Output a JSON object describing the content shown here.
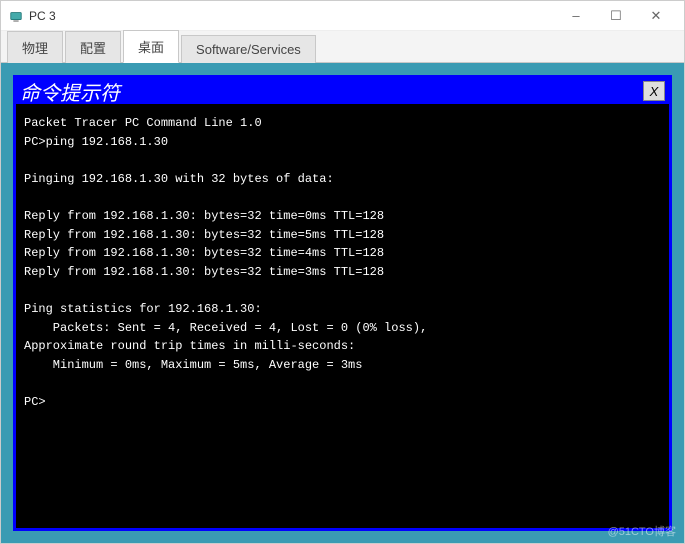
{
  "window": {
    "title": "PC 3",
    "controls": {
      "minimize": "–",
      "maximize": "☐",
      "close": "✕"
    }
  },
  "tabs": {
    "items": [
      {
        "label": "物理"
      },
      {
        "label": "配置"
      },
      {
        "label": "桌面"
      },
      {
        "label": "Software/Services"
      }
    ]
  },
  "console": {
    "title": "命令提示符",
    "close_label": "X",
    "lines": [
      "Packet Tracer PC Command Line 1.0",
      "PC>ping 192.168.1.30",
      "",
      "Pinging 192.168.1.30 with 32 bytes of data:",
      "",
      "Reply from 192.168.1.30: bytes=32 time=0ms TTL=128",
      "Reply from 192.168.1.30: bytes=32 time=5ms TTL=128",
      "Reply from 192.168.1.30: bytes=32 time=4ms TTL=128",
      "Reply from 192.168.1.30: bytes=32 time=3ms TTL=128",
      "",
      "Ping statistics for 192.168.1.30:",
      "    Packets: Sent = 4, Received = 4, Lost = 0 (0% loss),",
      "Approximate round trip times in milli-seconds:",
      "    Minimum = 0ms, Maximum = 5ms, Average = 3ms",
      "",
      "PC>"
    ]
  },
  "watermark": "@51CTO博客"
}
